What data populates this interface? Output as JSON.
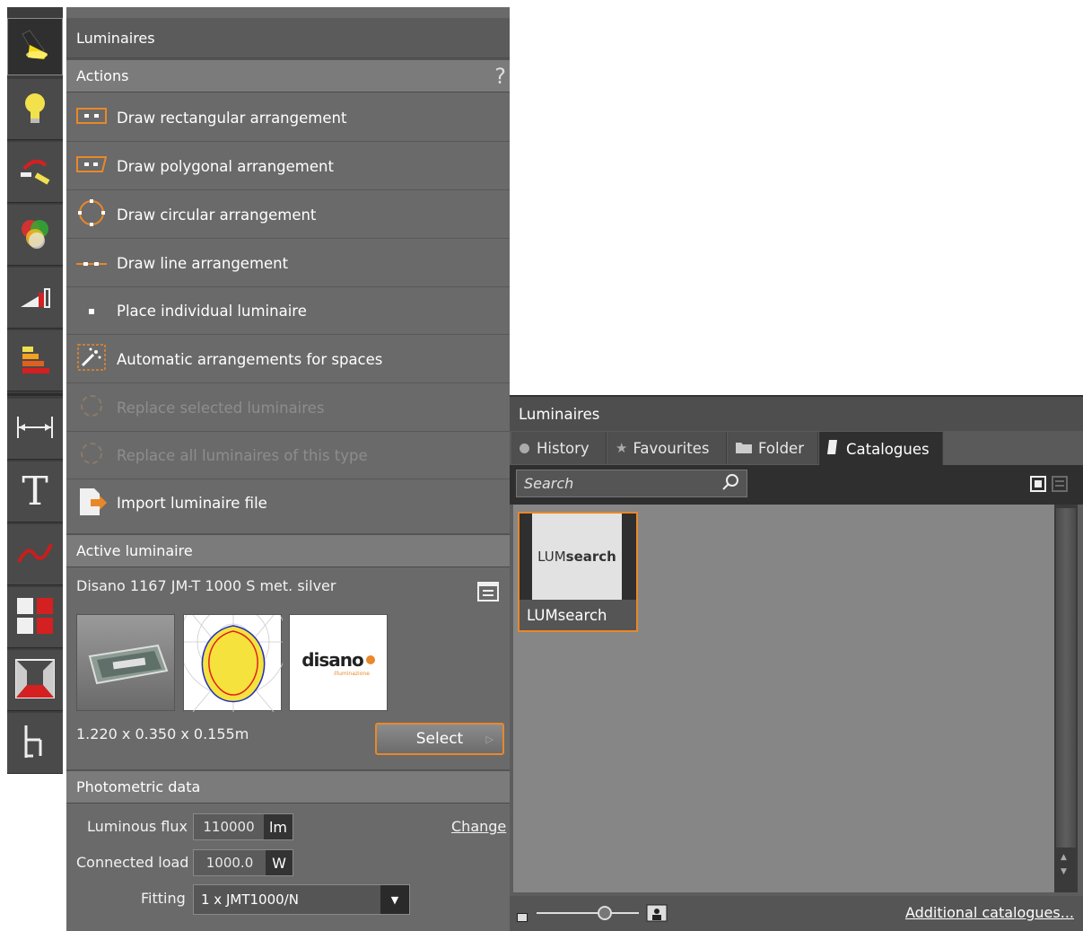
{
  "left_panel": {
    "title": "Luminaires",
    "actions_header": "Actions",
    "help": "?",
    "actions": [
      {
        "label": "Draw rectangular arrangement",
        "icon": "rectangular-arrangement-icon",
        "enabled": true
      },
      {
        "label": "Draw polygonal arrangement",
        "icon": "polygonal-arrangement-icon",
        "enabled": true
      },
      {
        "label": "Draw circular arrangement",
        "icon": "circular-arrangement-icon",
        "enabled": true
      },
      {
        "label": "Draw line arrangement",
        "icon": "line-arrangement-icon",
        "enabled": true
      },
      {
        "label": "Place individual luminaire",
        "icon": "single-luminaire-icon",
        "enabled": true
      },
      {
        "label": "Automatic arrangements for spaces",
        "icon": "magic-wand-icon",
        "enabled": true
      },
      {
        "label": "Replace selected luminaires",
        "icon": "replace-icon",
        "enabled": false
      },
      {
        "label": "Replace all luminaires of this type",
        "icon": "replace-all-icon",
        "enabled": false
      },
      {
        "label": "Import luminaire file",
        "icon": "import-file-icon",
        "enabled": true
      }
    ],
    "active_header": "Active luminaire",
    "active_name": "Disano 1167 JM-T 1000 S  met. silver",
    "dimensions": "1.220 x 0.350 x 0.155m",
    "select_label": "Select",
    "logo_text": "disano",
    "logo_sub": "illuminazione",
    "photometric_header": "Photometric data",
    "flux_label": "Luminous flux",
    "flux_value": "110000",
    "flux_unit": "lm",
    "change_label": "Change",
    "load_label": "Connected load",
    "load_value": "1000.0",
    "load_unit": "W",
    "fitting_label": "Fitting",
    "fitting_value": "1 x JMT1000/N"
  },
  "rail": {
    "items": [
      "luminaire-spot-icon",
      "light-bulb-icon",
      "light-scene-icon",
      "color-icon",
      "calculation-icon",
      "energy-icon",
      "dimension-icon",
      "text-icon",
      "curve-icon",
      "grid-icon",
      "room-icon",
      "tree-icon"
    ]
  },
  "right_panel": {
    "title": "Luminaires",
    "tabs": [
      "History",
      "Favourites",
      "Folder",
      "Catalogues"
    ],
    "search_placeholder": "Search",
    "catalogue_item": {
      "thumb_prefix": "LUM",
      "thumb_bold": "search",
      "label": "LUMsearch"
    },
    "additional_link": "Additional catalogues..."
  },
  "colors": {
    "accent": "#e8882a",
    "panel": "#6a6a6a",
    "dark": "#3d3d3d"
  }
}
